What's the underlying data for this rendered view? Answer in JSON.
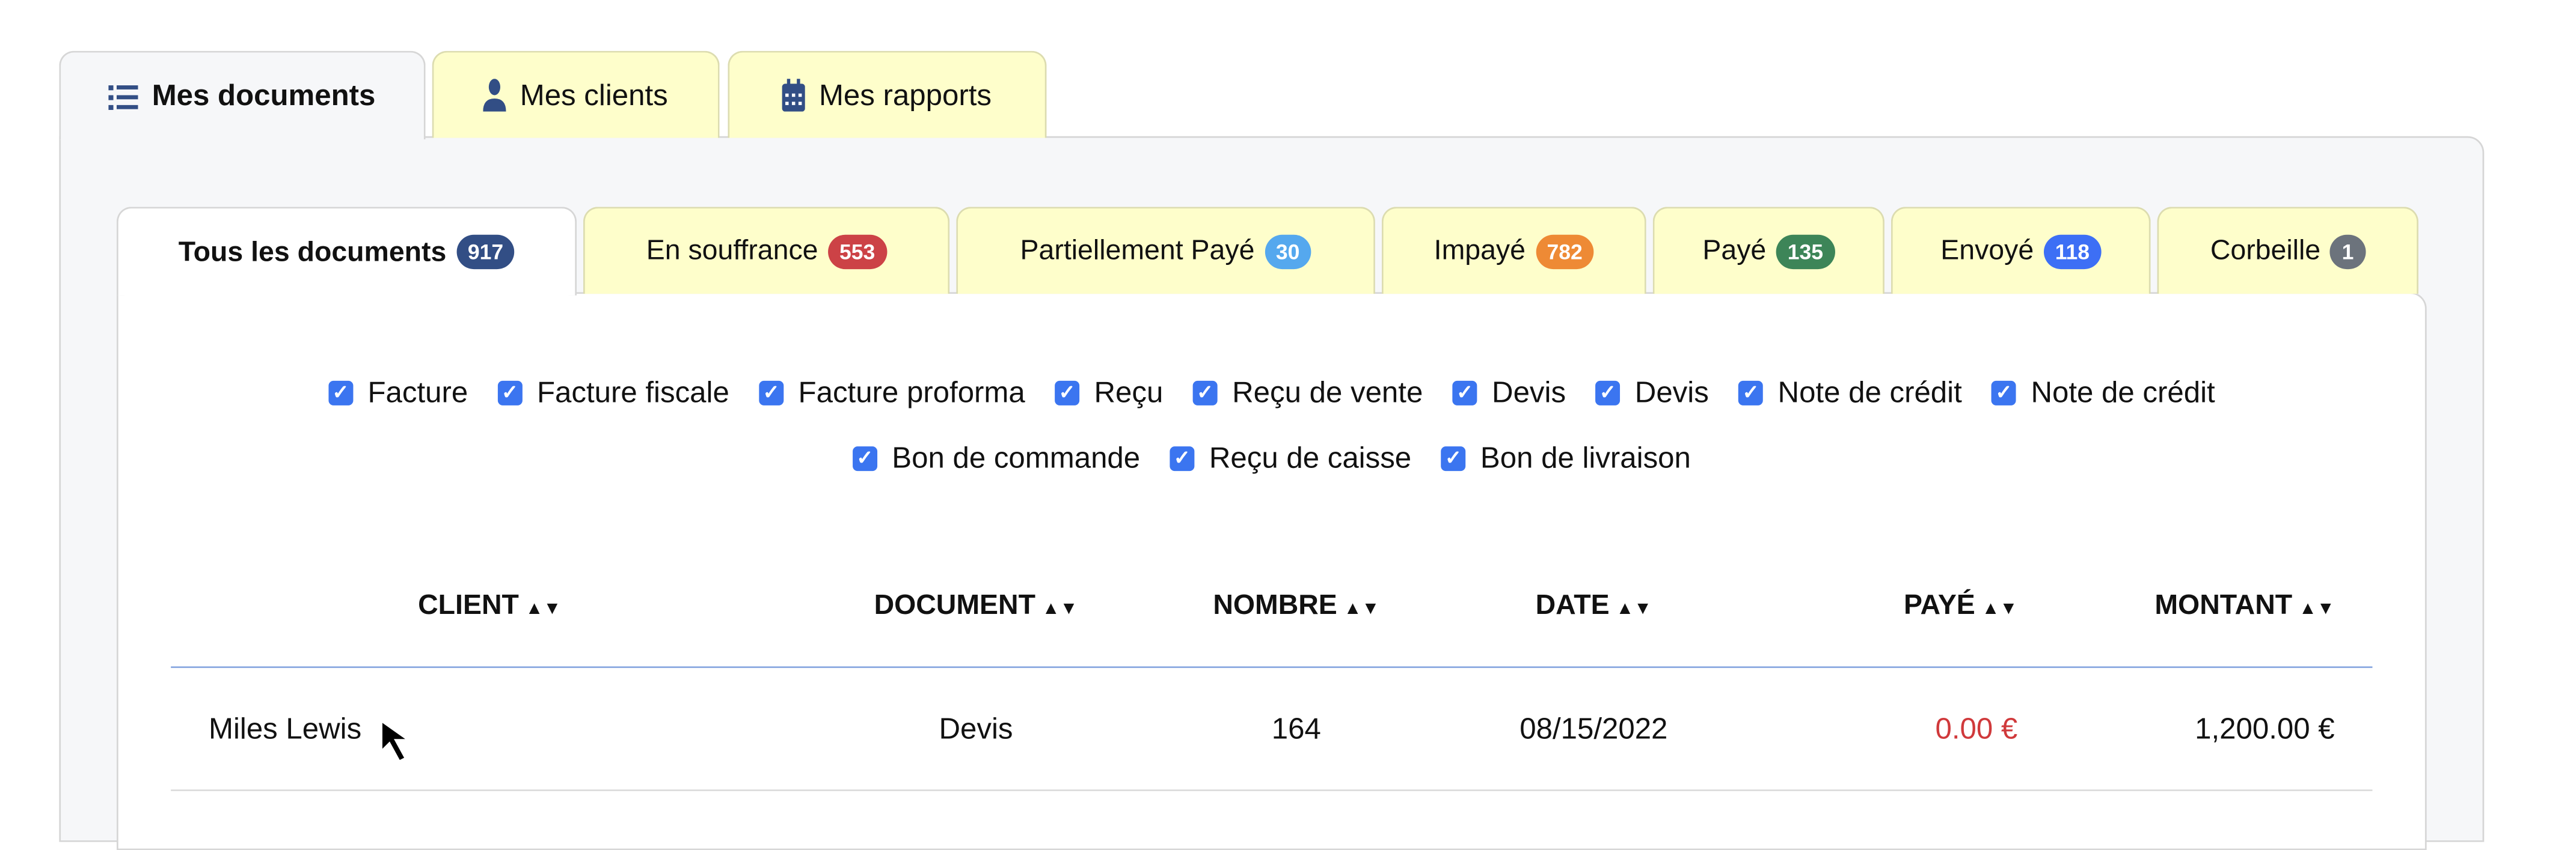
{
  "outer_tabs": [
    {
      "label": "Mes documents",
      "icon": "list-icon",
      "active": true
    },
    {
      "label": "Mes clients",
      "icon": "user-tie-icon",
      "active": false
    },
    {
      "label": "Mes rapports",
      "icon": "calendar-icon",
      "active": false
    }
  ],
  "inner_tabs": [
    {
      "label": "Tous les documents",
      "count": "917",
      "color": "#324e85"
    },
    {
      "label": "En souffrance",
      "count": "553",
      "color": "#cc4246"
    },
    {
      "label": "Partiellement Payé",
      "count": "30",
      "color": "#55a8ee"
    },
    {
      "label": "Impayé",
      "count": "782",
      "color": "#ee8a35"
    },
    {
      "label": "Payé",
      "count": "135",
      "color": "#3d8558"
    },
    {
      "label": "Envoyé",
      "count": "118",
      "color": "#3d6ff5"
    },
    {
      "label": "Corbeille",
      "count": "1",
      "color": "#6c737c"
    }
  ],
  "filters_row1": [
    "Facture",
    "Facture fiscale",
    "Facture proforma",
    "Reçu",
    "Reçu de vente",
    "Devis",
    "Devis",
    "Note de crédit",
    "Note de crédit"
  ],
  "filters_row2": [
    "Bon de commande",
    "Reçu de caisse",
    "Bon de livraison"
  ],
  "filters_checked": true,
  "table": {
    "headers": [
      "CLIENT",
      "DOCUMENT",
      "NOMBRE",
      "DATE",
      "PAYÉ",
      "MONTANT"
    ],
    "rows": [
      [
        "Miles Lewis",
        "Devis",
        "164",
        "08/15/2022",
        "0.00 €",
        "1,200.00 €"
      ]
    ]
  },
  "colors": {
    "tab_yellow": "#fefecb",
    "paid_red": "#d0393b",
    "header_line": "#8aa8e0",
    "checkbox": "#3b75f0"
  }
}
